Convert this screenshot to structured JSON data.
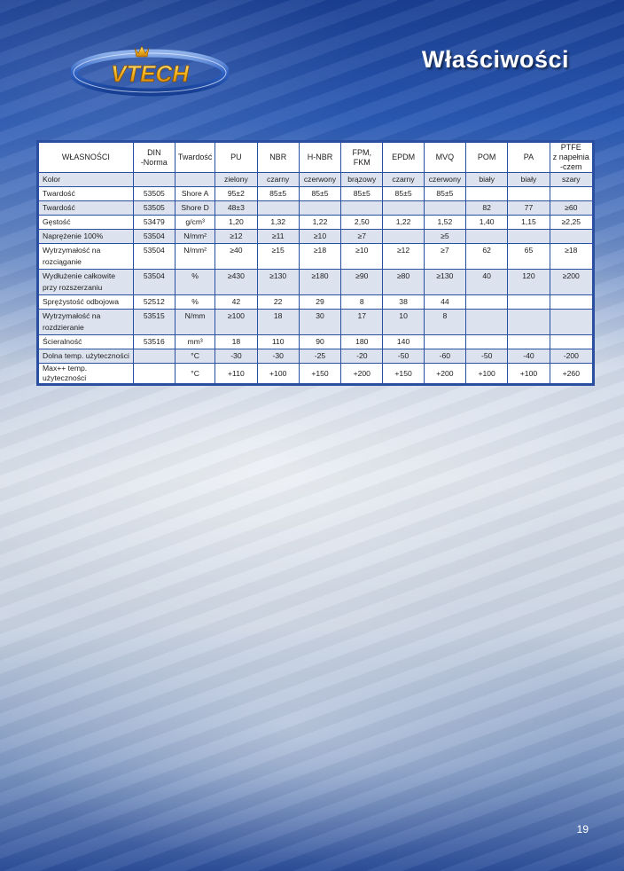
{
  "header": {
    "logo_text": "VTECH",
    "title": "Właściwości"
  },
  "table": {
    "columns": [
      "WŁASNOŚCI",
      "DIN\n-Norma",
      "Twardość",
      "PU",
      "NBR",
      "H-NBR",
      "FPM, FKM",
      "EPDM",
      "MVQ",
      "POM",
      "PA",
      "PTFE\nz napełnia\n-czem"
    ],
    "rows": [
      [
        "Kolor",
        "",
        "",
        "zielony",
        "czarny",
        "czerwony",
        "brązowy",
        "czarny",
        "czerwony",
        "biały",
        "biały",
        "szary"
      ],
      [
        "Twardość",
        "53505",
        "Shore A",
        "95±2",
        "85±5",
        "85±5",
        "85±5",
        "85±5",
        "85±5",
        "",
        "",
        ""
      ],
      [
        "Twardość",
        "53505",
        "Shore D",
        "48±3",
        "",
        "",
        "",
        "",
        "",
        "82",
        "77",
        "≥60"
      ],
      [
        "Gęstość",
        "53479",
        "g/cm³",
        "1,20",
        "1,32",
        "1,22",
        "2,50",
        "1,22",
        "1,52",
        "1,40",
        "1,15",
        "≥2,25"
      ],
      [
        "Naprężenie 100%",
        "53504",
        "N/mm²",
        "≥12",
        "≥11",
        "≥10",
        "≥7",
        "",
        "≥5",
        "",
        "",
        ""
      ],
      [
        "Wytrzymałość na\nrozciąganie",
        "53504",
        "N/mm²",
        "≥40",
        "≥15",
        "≥18",
        "≥10",
        "≥12",
        "≥7",
        "62",
        "65",
        "≥18"
      ],
      [
        "Wydłużenie całkowite\nprzy rozszerzaniu",
        "53504",
        "%",
        "≥430",
        "≥130",
        "≥180",
        "≥90",
        "≥80",
        "≥130",
        "40",
        "120",
        "≥200"
      ],
      [
        "Sprężystość odbojowa",
        "52512",
        "%",
        "42",
        "22",
        "29",
        "8",
        "38",
        "44",
        "",
        "",
        ""
      ],
      [
        "Wytrzymałość na\nrozdzieranie",
        "53515",
        "N/mm",
        "≥100",
        "18",
        "30",
        "17",
        "10",
        "8",
        "",
        "",
        ""
      ],
      [
        "Ścieralność",
        "53516",
        "mm³",
        "18",
        "110",
        "90",
        "180",
        "140",
        "",
        "",
        "",
        ""
      ],
      [
        "Dolna temp. użyteczności",
        "",
        "°C",
        "-30",
        "-30",
        "-25",
        "-20",
        "-50",
        "-60",
        "-50",
        "-40",
        "-200"
      ],
      [
        "Max++ temp. użyteczności",
        "",
        "°C",
        "+110",
        "+100",
        "+150",
        "+200",
        "+150",
        "+200",
        "+100",
        "+100",
        "+260"
      ]
    ]
  },
  "footer": {
    "page_number": "19"
  },
  "colors": {
    "border": "#2b4fa0",
    "row_shade": "#dde3ee",
    "title": "#ffffff"
  }
}
